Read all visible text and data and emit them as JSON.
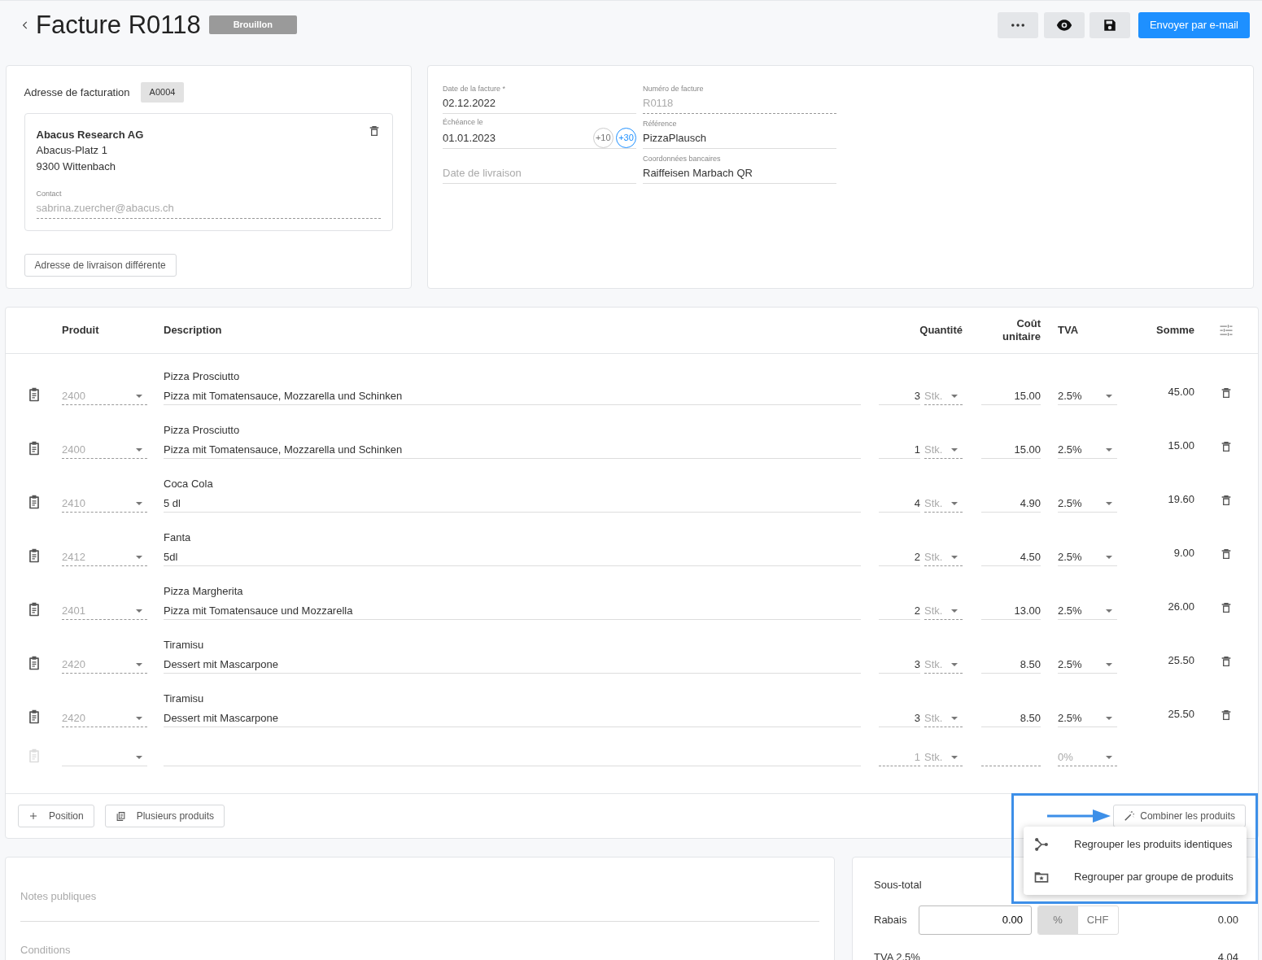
{
  "header": {
    "title": "Facture R0118",
    "status": "Brouillon",
    "send_button": "Envoyer par e-mail"
  },
  "billing": {
    "label": "Adresse de facturation",
    "code": "A0004",
    "company": "Abacus Research AG",
    "street": "Abacus-Platz 1",
    "city": "9300 Wittenbach",
    "contact_label": "Contact",
    "contact": "sabrina.zuercher@abacus.ch",
    "delivery_button": "Adresse de livraison différente"
  },
  "invoice_columns": [
    [
      {
        "label": "Date de la facture *",
        "value": "02.12.2022",
        "disabled": false
      },
      {
        "label": "Échéance le",
        "value": "01.01.2023",
        "disabled": false,
        "shortcuts": [
          {
            "label": "+10",
            "selected": false
          },
          {
            "label": "+30",
            "selected": true
          }
        ]
      },
      {
        "placeholder": "Date de livraison",
        "disabled": false
      }
    ],
    [
      {
        "label": "Numéro de facture",
        "value": "R0118",
        "disabled": true
      },
      {
        "label": "Référence",
        "value": "PizzaPlausch",
        "disabled": false
      },
      {
        "label": "Coordonnées bancaires",
        "value": "Raiffeisen Marbach QR",
        "disabled": false
      }
    ]
  ],
  "table": {
    "columns": [
      "Produit",
      "Description",
      "Quantité",
      "Coût unitaire",
      "TVA",
      "Somme"
    ],
    "rows": [
      {
        "product": "2400",
        "title": "Pizza Prosciutto",
        "description": "Pizza mit Tomatensauce, Mozzarella und Schinken",
        "quantity": "3",
        "unit": "Stk.",
        "unit_cost": "15.00",
        "vat": "2.5%",
        "sum": "45.00"
      },
      {
        "product": "2400",
        "title": "Pizza Prosciutto",
        "description": "Pizza mit Tomatensauce, Mozzarella und Schinken",
        "quantity": "1",
        "unit": "Stk.",
        "unit_cost": "15.00",
        "vat": "2.5%",
        "sum": "15.00"
      },
      {
        "product": "2410",
        "title": "Coca Cola",
        "description": "5 dl",
        "quantity": "4",
        "unit": "Stk.",
        "unit_cost": "4.90",
        "vat": "2.5%",
        "sum": "19.60"
      },
      {
        "product": "2412",
        "title": "Fanta",
        "description": "5dl",
        "quantity": "2",
        "unit": "Stk.",
        "unit_cost": "4.50",
        "vat": "2.5%",
        "sum": "9.00"
      },
      {
        "product": "2401",
        "title": "Pizza Margherita",
        "description": "Pizza mit Tomatensauce und Mozzarella",
        "quantity": "2",
        "unit": "Stk.",
        "unit_cost": "13.00",
        "vat": "2.5%",
        "sum": "26.00"
      },
      {
        "product": "2420",
        "title": "Tiramisu",
        "description": "Dessert mit Mascarpone",
        "quantity": "3",
        "unit": "Stk.",
        "unit_cost": "8.50",
        "vat": "2.5%",
        "sum": "25.50"
      },
      {
        "product": "2420",
        "title": "Tiramisu",
        "description": "Dessert mit Mascarpone",
        "quantity": "3",
        "unit": "Stk.",
        "unit_cost": "8.50",
        "vat": "2.5%",
        "sum": "25.50"
      }
    ],
    "new_row": {
      "quantity_placeholder": "1",
      "unit": "Stk.",
      "vat_placeholder": "0%"
    }
  },
  "actions": {
    "add_position": "Position",
    "multiple_products": "Plusieurs produits",
    "combine": "Combiner les produits"
  },
  "combine_menu": [
    {
      "kind": "merge",
      "label": "Regrouper les produits identiques"
    },
    {
      "kind": "folder",
      "label": "Regrouper par groupe de produits"
    }
  ],
  "notes": [
    {
      "placeholder": "Notes publiques"
    },
    {
      "placeholder": "Conditions"
    }
  ],
  "totals": {
    "subtotal_label": "Sous-total",
    "discount": {
      "label": "Rabais",
      "value": "0.00",
      "modes": [
        {
          "label": "%",
          "selected": true
        },
        {
          "label": "CHF",
          "selected": false
        }
      ],
      "amount": "0.00"
    },
    "vat": {
      "label": "TVA 2.5%",
      "amount": "4.04"
    }
  }
}
